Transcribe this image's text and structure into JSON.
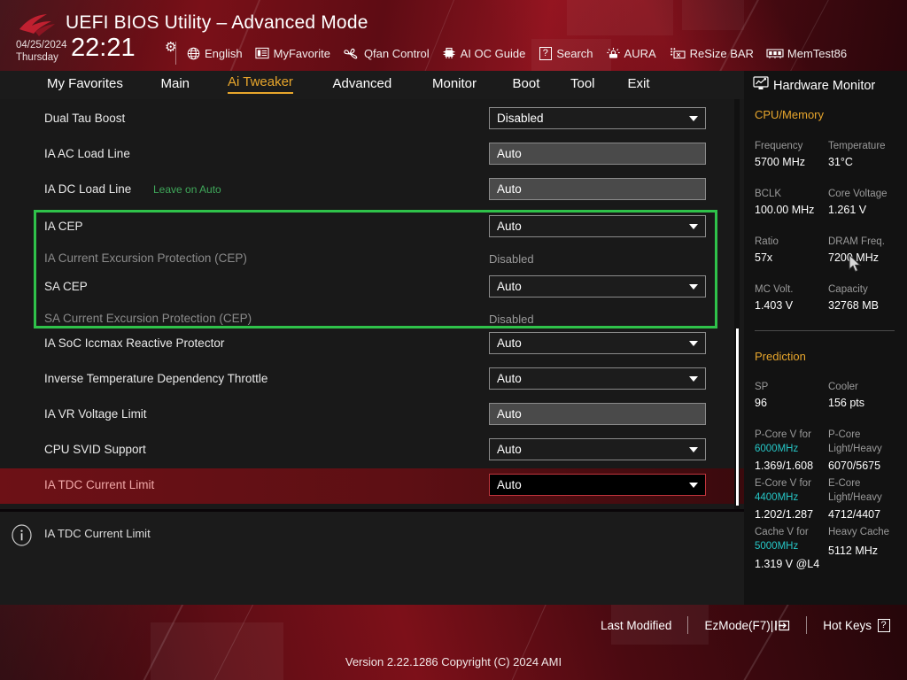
{
  "header": {
    "logo_icon": "rog-logo-icon",
    "title": "UEFI BIOS Utility – Advanced Mode",
    "date": "04/25/2024",
    "day": "Thursday",
    "time": "22:21",
    "gear_icon": "gear-icon",
    "items": [
      {
        "label": "English",
        "icon": "globe-icon"
      },
      {
        "label": "MyFavorite",
        "icon": "favorites-list-icon"
      },
      {
        "label": "Qfan Control",
        "icon": "fan-icon"
      },
      {
        "label": "AI OC Guide",
        "icon": "ai-chip-icon"
      },
      {
        "label": "Search",
        "icon": "question-box-icon"
      },
      {
        "label": "AURA",
        "icon": "aura-light-icon"
      },
      {
        "label": "ReSize BAR",
        "icon": "resize-bar-icon"
      },
      {
        "label": "MemTest86",
        "icon": "memory-module-icon"
      }
    ]
  },
  "nav": {
    "tabs": [
      {
        "label": "My Favorites",
        "active": false
      },
      {
        "label": "Main",
        "active": false
      },
      {
        "label": "Ai Tweaker",
        "active": true
      },
      {
        "label": "Advanced",
        "active": false
      },
      {
        "label": "Monitor",
        "active": false
      },
      {
        "label": "Boot",
        "active": false
      },
      {
        "label": "Tool",
        "active": false
      },
      {
        "label": "Exit",
        "active": false
      }
    ],
    "active_color": "#e8a62c"
  },
  "settings": {
    "annotation_color": "#2fc24a",
    "rows": [
      {
        "label": "Dual Tau Boost",
        "hint": "",
        "control": "select",
        "value": "Disabled",
        "dim": false,
        "selected": false
      },
      {
        "label": "IA AC Load Line",
        "hint": "",
        "control": "input",
        "value": "Auto",
        "dim": false,
        "selected": false
      },
      {
        "label": "IA DC Load Line",
        "hint": "Leave on Auto",
        "control": "input",
        "value": "Auto",
        "dim": false,
        "selected": false
      },
      {
        "label": "IA CEP",
        "hint": "",
        "control": "select",
        "value": "Auto",
        "dim": false,
        "selected": false
      },
      {
        "label": "IA Current Excursion Protection (CEP)",
        "hint": "",
        "control": "text",
        "value": "Disabled",
        "dim": true,
        "selected": false
      },
      {
        "label": "SA CEP",
        "hint": "",
        "control": "select",
        "value": "Auto",
        "dim": false,
        "selected": false
      },
      {
        "label": "SA Current Excursion Protection (CEP)",
        "hint": "",
        "control": "text",
        "value": "Disabled",
        "dim": true,
        "selected": false
      },
      {
        "label": "IA SoC Iccmax Reactive Protector",
        "hint": "",
        "control": "select",
        "value": "Auto",
        "dim": false,
        "selected": false
      },
      {
        "label": "Inverse Temperature Dependency Throttle",
        "hint": "",
        "control": "select",
        "value": "Auto",
        "dim": false,
        "selected": false
      },
      {
        "label": "IA VR Voltage Limit",
        "hint": "",
        "control": "input",
        "value": "Auto",
        "dim": false,
        "selected": false
      },
      {
        "label": "CPU SVID Support",
        "hint": "",
        "control": "select",
        "value": "Auto",
        "dim": false,
        "selected": false
      },
      {
        "label": "IA TDC Current Limit",
        "hint": "",
        "control": "select",
        "value": "Auto",
        "dim": false,
        "selected": true
      }
    ]
  },
  "info_bar": {
    "icon": "info-icon",
    "text": "IA TDC Current Limit"
  },
  "hardware_monitor": {
    "icon": "monitor-icon",
    "title": "Hardware Monitor",
    "cpu_memory": {
      "title": "CPU/Memory",
      "pairs": [
        {
          "k1": "Frequency",
          "v1": "5700 MHz",
          "k2": "Temperature",
          "v2": "31°C"
        },
        {
          "k1": "BCLK",
          "v1": "100.00 MHz",
          "k2": "Core Voltage",
          "v2": "1.261 V"
        },
        {
          "k1": "Ratio",
          "v1": "57x",
          "k2": "DRAM Freq.",
          "v2": "7200 MHz"
        },
        {
          "k1": "MC Volt.",
          "v1": "1.403 V",
          "k2": "Capacity",
          "v2": "32768 MB"
        }
      ]
    },
    "prediction": {
      "title": "Prediction",
      "sp_label": "SP",
      "sp_value": "96",
      "cooler_label": "Cooler",
      "cooler_value": "156 pts",
      "pcore_k1": "P-Core V for",
      "pcore_freq": "6000MHz",
      "pcore_v": "1.369/1.608",
      "pcore_k2a": "P-Core",
      "pcore_k2b": "Light/Heavy",
      "pcore_lh": "6070/5675",
      "ecore_k1": "E-Core V for",
      "ecore_freq": "4400MHz",
      "ecore_v": "1.202/1.287",
      "ecore_k2a": "E-Core",
      "ecore_k2b": "Light/Heavy",
      "ecore_lh": "4712/4407",
      "cache_k1": "Cache V for",
      "cache_freq": "5000MHz",
      "cache_v": "1.319 V @L4",
      "cache_k2": "Heavy Cache",
      "cache_heavy": "5112 MHz"
    },
    "accent_color": "#e8a62c",
    "freq_color": "#26c6c6"
  },
  "footer": {
    "items": [
      {
        "label": "Last Modified",
        "icon": ""
      },
      {
        "label": "EzMode(F7)|",
        "icon": "exit-arrow-icon"
      },
      {
        "label": "Hot Keys",
        "icon": "question-box-icon"
      }
    ],
    "version": "Version 2.22.1286 Copyright (C) 2024 AMI"
  },
  "cursor": {
    "icon": "mouse-pointer-icon"
  }
}
